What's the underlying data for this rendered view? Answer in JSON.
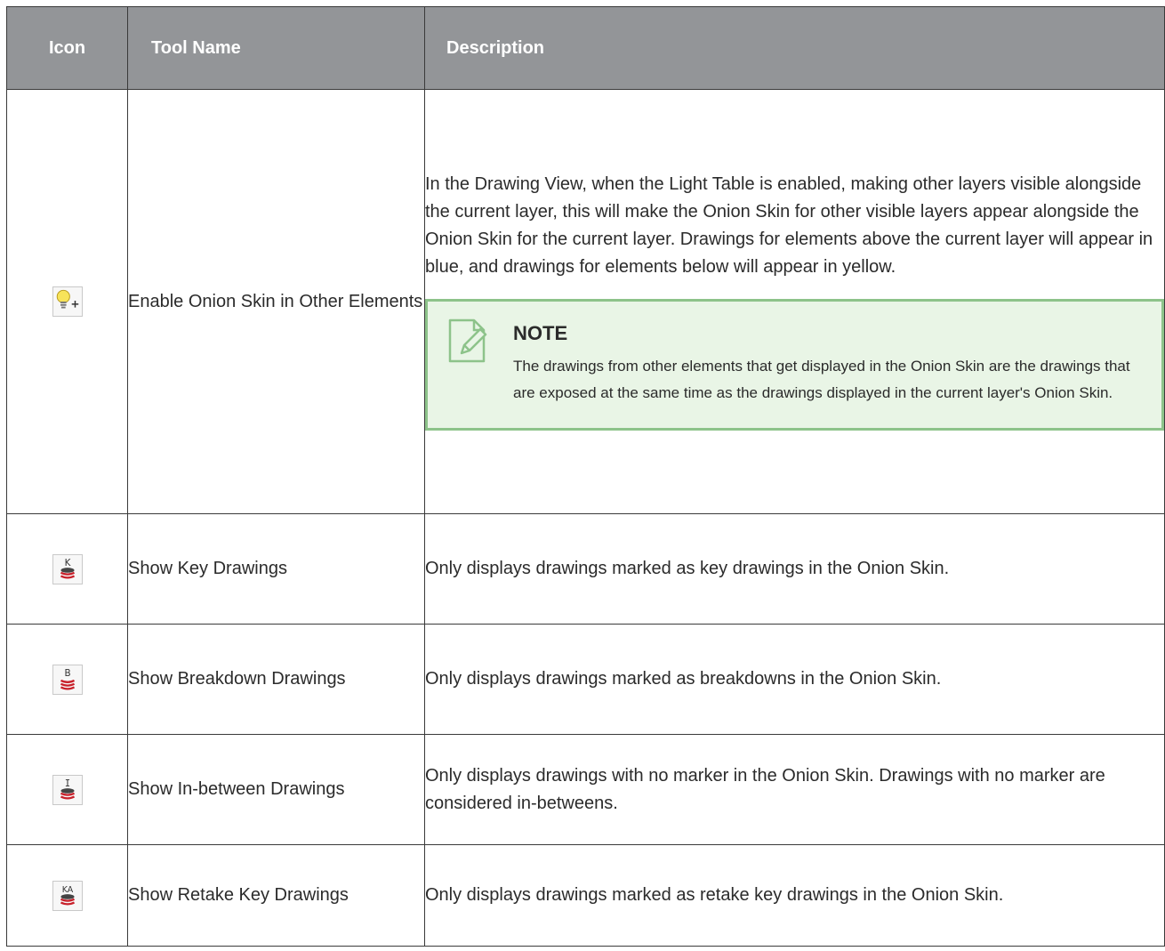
{
  "header": {
    "icon": "Icon",
    "tool_name": "Tool Name",
    "description": "Description"
  },
  "rows": [
    {
      "icon": "onion-skin-other-elements-icon",
      "name": "Enable Onion Skin in Other Elements",
      "description": "In the Drawing View, when the Light Table is enabled, making other layers visible alongside the current layer, this will make the Onion Skin for other visible layers appear alongside the Onion Skin for the current layer. Drawings for elements above the current layer will appear in blue, and drawings for elements below will appear in yellow.",
      "note": {
        "title": "NOTE",
        "text": "The drawings from other elements that get displayed in the Onion Skin are the drawings that are exposed at the same time as the drawings displayed in the current layer's Onion Skin."
      }
    },
    {
      "icon": "key-drawings-icon",
      "icon_letter": "K",
      "name": "Show Key Drawings",
      "description": "Only displays drawings marked as key drawings in the Onion Skin."
    },
    {
      "icon": "breakdown-drawings-icon",
      "icon_letter": "B",
      "name": "Show Breakdown Drawings",
      "description": "Only displays drawings marked as breakdowns in the Onion Skin."
    },
    {
      "icon": "in-between-drawings-icon",
      "icon_letter": "I",
      "name": "Show In-between Drawings",
      "description": "Only displays drawings with no marker in the Onion Skin. Drawings with no marker are considered in-betweens."
    },
    {
      "icon": "retake-key-drawings-icon",
      "icon_letter": "KA",
      "name": "Show Retake Key Drawings",
      "description": "Only displays drawings marked as retake key drawings in the Onion Skin."
    }
  ],
  "colors": {
    "header_bg": "#939598",
    "note_bg": "#e9f5e6",
    "note_border": "#8dc38a",
    "stack_red": "#c8202a",
    "stack_dark": "#444444",
    "bulb_yellow": "#f7e35a"
  }
}
